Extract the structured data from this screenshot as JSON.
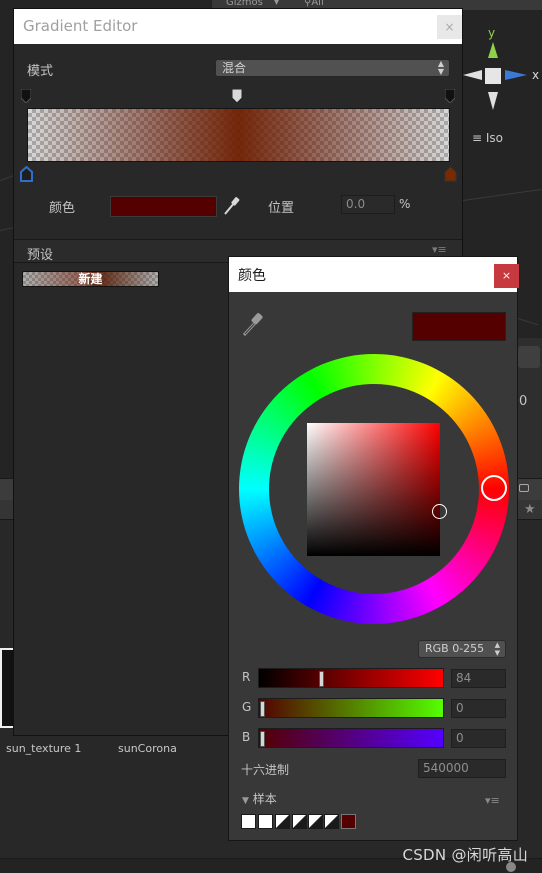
{
  "background": {
    "gizmos_menu": "Gizmos",
    "search_label": "All",
    "axis_labels": {
      "y": "y",
      "x": "x"
    },
    "projection_label": "Iso",
    "inspector_value": "0",
    "assets": [
      {
        "name": "sun_texture 1"
      },
      {
        "name": "sunCorona"
      }
    ]
  },
  "gradient_editor": {
    "title": "Gradient Editor",
    "close_glyph": "×",
    "mode_label": "模式",
    "mode_value": "混合",
    "color_label": "颜色",
    "location_label": "位置",
    "location_value": "0.0",
    "location_unit": "%",
    "presets_label": "预设",
    "presets_menu_glyph": "▾≡",
    "new_preset_label": "新建",
    "selected_key_color": "#540000"
  },
  "color_picker": {
    "title": "颜色",
    "close_glyph": "×",
    "current_color": "#540000",
    "mode_select": "RGB 0-255",
    "channels": [
      {
        "label": "R",
        "value": "84",
        "level": 0.33,
        "gradient": "linear-gradient(to right, #000000, #ff0000)"
      },
      {
        "label": "G",
        "value": "0",
        "level": 0.0,
        "gradient": "linear-gradient(to right, #540000, #54ff00)"
      },
      {
        "label": "B",
        "value": "0",
        "level": 0.0,
        "gradient": "linear-gradient(to right, #540000, #5400ff)"
      }
    ],
    "hex_label": "十六进制",
    "hex_value": "540000",
    "swatches_label": "样本",
    "swatches_menu_glyph": "▾≡",
    "swatches_toggle_glyph": "▼"
  },
  "watermark": "CSDN @闲听高山",
  "colors": {
    "accent_blue": "#2c6fd1",
    "gizmo_y": "#8fd14a",
    "gizmo_x": "#d64a3a",
    "gizmo_z": "#3a7ad6",
    "close_red": "#c6393f"
  }
}
